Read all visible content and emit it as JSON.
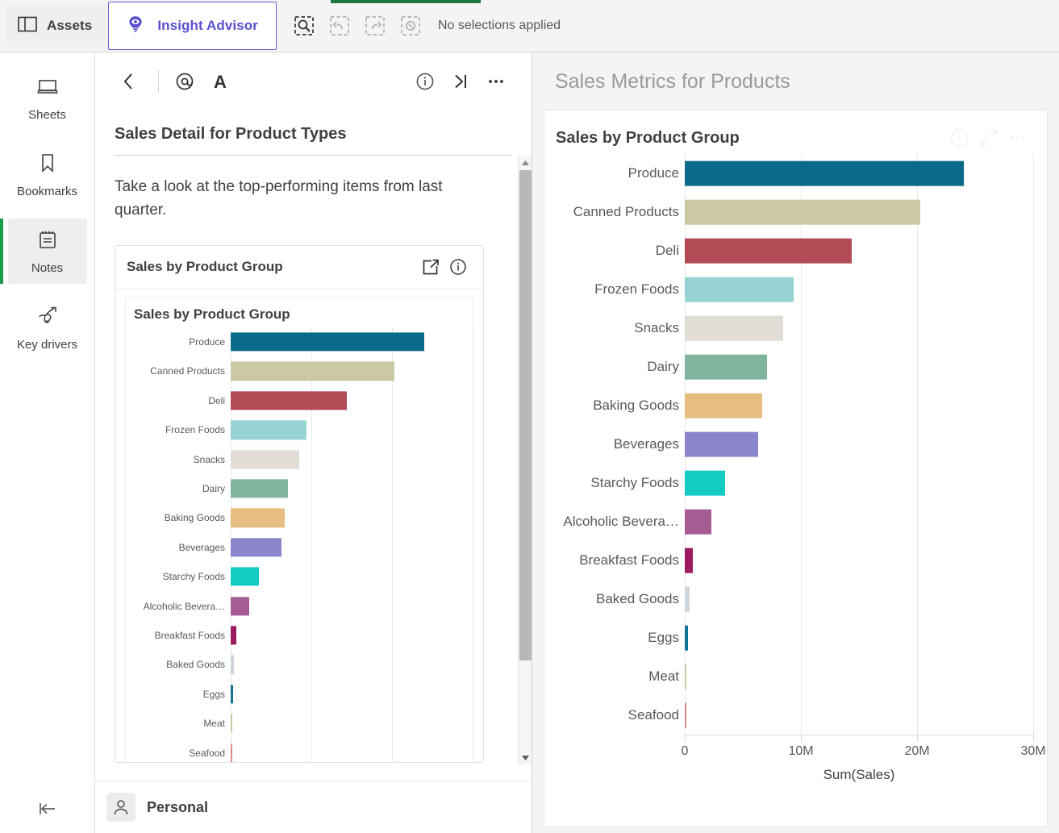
{
  "topbar": {
    "assets_label": "Assets",
    "advisor_label": "Insight Advisor",
    "selection_status": "No selections applied",
    "icons": {
      "assets": "panel-icon",
      "advisor": "lightbulb-eye-icon",
      "smart_search": "smart-search-icon",
      "step_back": "step-back-icon",
      "step_forward": "step-forward-icon",
      "clear": "clear-selections-icon"
    },
    "accent_purple": "#5a4fcf",
    "accent_green": "#1a7a3e"
  },
  "sidebar": {
    "items": [
      {
        "label": "Sheets",
        "icon": "sheets-icon",
        "active": false
      },
      {
        "label": "Bookmarks",
        "icon": "bookmark-icon",
        "active": false
      },
      {
        "label": "Notes",
        "icon": "notes-icon",
        "active": true
      },
      {
        "label": "Key drivers",
        "icon": "key-drivers-icon",
        "active": false
      }
    ],
    "collapse_icon": "collapse-left-icon",
    "active_marker_color": "#1a9c4c"
  },
  "notes_panel": {
    "toolbar": {
      "back": "chevron-left-icon",
      "mention": "at-mention-icon",
      "text_format": "text-format-icon",
      "info": "info-circle-icon",
      "expand": "expand-right-icon",
      "more": "more-options-icon"
    },
    "title": "Sales Detail for Product Types",
    "paragraph": "Take a look at the top-performing items from last quarter.",
    "embedded_card": {
      "title": "Sales by Product Group",
      "share_icon": "share-external-icon",
      "info_icon": "info-circle-icon",
      "chart_title": "Sales by Product Group"
    },
    "footer": {
      "avatar_icon": "user-avatar-icon",
      "name": "Personal"
    }
  },
  "main": {
    "title": "Sales Metrics for Products",
    "card": {
      "title": "Sales by Product Group",
      "info_icon": "info-circle-icon",
      "fullscreen_icon": "fullscreen-expand-icon",
      "more_icon": "more-options-icon"
    }
  },
  "chart_data": {
    "type": "bar",
    "orientation": "horizontal",
    "title": "Sales by Product Group",
    "xlabel": "Sum(Sales)",
    "ylabel": "",
    "xlim": [
      0,
      30000000
    ],
    "xticks": [
      0,
      10000000,
      20000000,
      30000000
    ],
    "xtick_labels": [
      "0",
      "10M",
      "20M",
      "30M"
    ],
    "grid": true,
    "legend": false,
    "categories": [
      "Produce",
      "Canned Products",
      "Deli",
      "Frozen Foods",
      "Snacks",
      "Dairy",
      "Baking Goods",
      "Beverages",
      "Starchy Foods",
      "Alcoholic Bevera…",
      "Breakfast Foods",
      "Baked Goods",
      "Eggs",
      "Meat",
      "Seafood"
    ],
    "values": [
      24000000,
      20300000,
      14400000,
      9400000,
      8500000,
      7100000,
      6700000,
      6300000,
      3500000,
      2300000,
      700000,
      400000,
      300000,
      100000,
      60000
    ],
    "colors": [
      "#0a6a8a",
      "#cbc9a4",
      "#b24b55",
      "#97d3d3",
      "#e2dcd7",
      "#80b49c",
      "#e7bd82",
      "#8b85cc",
      "#12ccc4",
      "#a45c93",
      "#9a1c5e",
      "#ccd5dd",
      "#0f7491",
      "#c8c79e",
      "#d98a8a"
    ]
  }
}
